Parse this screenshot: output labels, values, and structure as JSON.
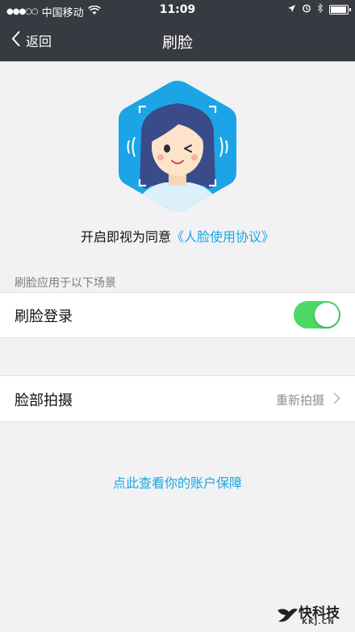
{
  "status_bar": {
    "carrier": "中国移动",
    "time": "11:09",
    "signal": "●●●○○"
  },
  "nav": {
    "back_label": "返回",
    "title": "刷脸"
  },
  "agreement": {
    "prefix": "开启即视为同意",
    "link": "《人脸使用协议》"
  },
  "section": {
    "title": "刷脸应用于以下场景"
  },
  "face_login": {
    "label": "刷脸登录",
    "enabled": true
  },
  "face_capture": {
    "label": "脸部拍摄",
    "value": "重新拍摄"
  },
  "account_protection_link": "点此查看你的账户保障",
  "watermark": {
    "main": "快科技",
    "sub": "KKJ.CN"
  },
  "colors": {
    "header": "#383a41",
    "accent": "#1aa7e4",
    "toggle_on": "#4cd964",
    "background": "#f2f2f4"
  }
}
